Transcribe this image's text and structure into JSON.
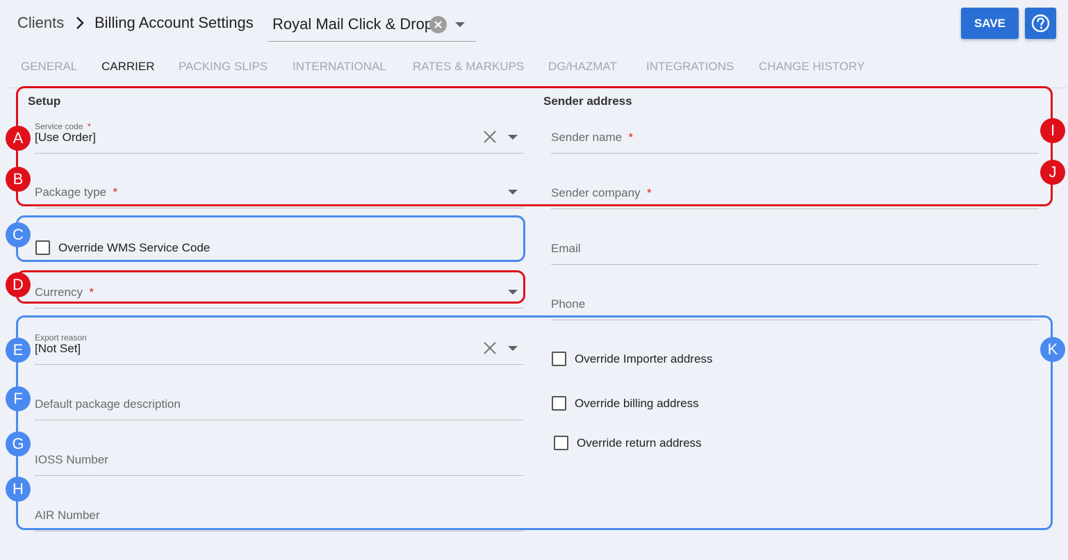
{
  "header": {
    "breadcrumb_root": "Clients",
    "breadcrumb_current": "Billing Account Settings",
    "account_selected": "Royal Mail Click & Drop",
    "save_label": "SAVE"
  },
  "tabs": [
    {
      "label": "GENERAL"
    },
    {
      "label": "CARRIER"
    },
    {
      "label": "PACKING SLIPS"
    },
    {
      "label": "INTERNATIONAL"
    },
    {
      "label": "RATES & MARKUPS"
    },
    {
      "label": "DG/HAZMAT"
    },
    {
      "label": "INTEGRATIONS"
    },
    {
      "label": "CHANGE HISTORY"
    }
  ],
  "active_tab": "CARRIER",
  "setup": {
    "title": "Setup",
    "service_code": {
      "label": "Service code",
      "required_mark": "*",
      "value": "[Use Order]"
    },
    "package_type": {
      "label": "Package type",
      "required_mark": "*"
    },
    "override_wms": {
      "label": "Override WMS Service Code"
    },
    "currency": {
      "label": "Currency",
      "required_mark": "*"
    },
    "export_reason": {
      "label": "Export reason",
      "value": "[Not Set]"
    },
    "default_package_description": {
      "label": "Default package description"
    },
    "ioss_number": {
      "label": "IOSS Number"
    },
    "air_number": {
      "label": "AIR Number"
    }
  },
  "sender": {
    "title": "Sender address",
    "sender_name": {
      "label": "Sender name",
      "required_mark": "*"
    },
    "sender_company": {
      "label": "Sender company",
      "required_mark": "*"
    },
    "email": {
      "label": "Email"
    },
    "phone": {
      "label": "Phone"
    },
    "override_importer": {
      "label": "Override Importer address"
    },
    "override_billing": {
      "label": "Override billing address"
    },
    "override_return": {
      "label": "Override return address"
    }
  },
  "markers": [
    "A",
    "B",
    "C",
    "D",
    "E",
    "F",
    "G",
    "H",
    "I",
    "J",
    "K"
  ],
  "colors": {
    "accent": "#2a6fd6",
    "annotation_red": "#e0101a",
    "annotation_blue": "#4a8af0",
    "required": "#e0201a"
  },
  "icons": {
    "breadcrumb_separator": "chevron-right-icon",
    "clear": "close-icon",
    "dropdown": "caret-down-icon",
    "help": "help-circle-icon"
  }
}
